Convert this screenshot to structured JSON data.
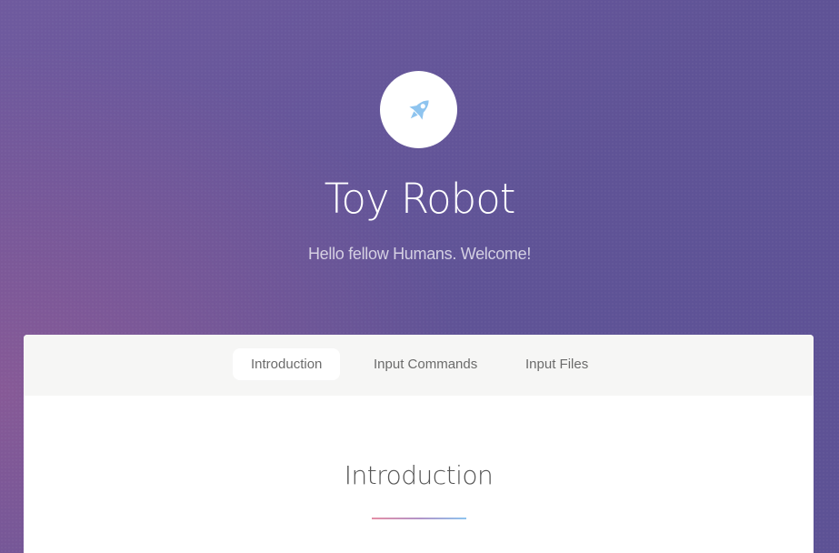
{
  "hero": {
    "logo_icon": "rocket-icon",
    "title": "Toy Robot",
    "subtitle": "Hello fellow Humans. Welcome!"
  },
  "nav": {
    "tabs": [
      {
        "label": "Introduction",
        "active": true
      },
      {
        "label": "Input Commands",
        "active": false
      },
      {
        "label": "Input Files",
        "active": false
      }
    ]
  },
  "main": {
    "section_title": "Introduction"
  },
  "colors": {
    "background_top": "#6f5a9e",
    "background_accent": "#8c5a96",
    "icon": "#8ec4ef",
    "underline_start": "#e58fa6",
    "underline_end": "#8ec4ef"
  }
}
